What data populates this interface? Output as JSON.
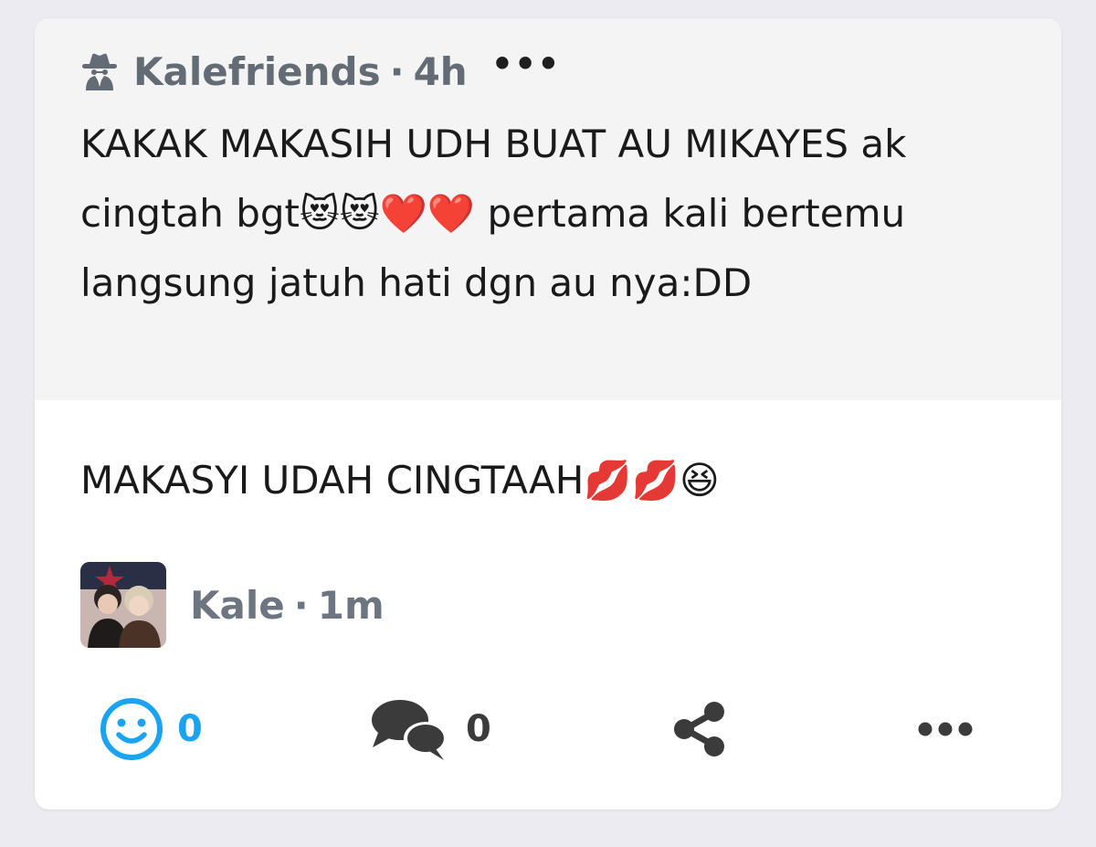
{
  "quote": {
    "icon": "spy-icon",
    "author": "Kalefriends",
    "separator": "·",
    "time": "4h",
    "more_label": "•••",
    "text": "KAKAK MAKASIH UDH BUAT AU MIKAYES ak cingtah bgt😻😻❤️❤️ pertama kali bertemu langsung jatuh hati dgn au nya:DD"
  },
  "reply": {
    "text": "MAKASYI UDAH CINGTAAH💋💋😆"
  },
  "author": {
    "name": "Kale",
    "separator": "·",
    "time": "1m"
  },
  "actions": {
    "react_count": "0",
    "comment_count": "0",
    "more_label": "•••"
  },
  "colors": {
    "accent": "#1aa3f0",
    "icon_dark": "#3b3b3b",
    "meta_gray": "#6d7680",
    "quote_bg": "#f4f4f5",
    "page_bg": "#ecebf1"
  }
}
